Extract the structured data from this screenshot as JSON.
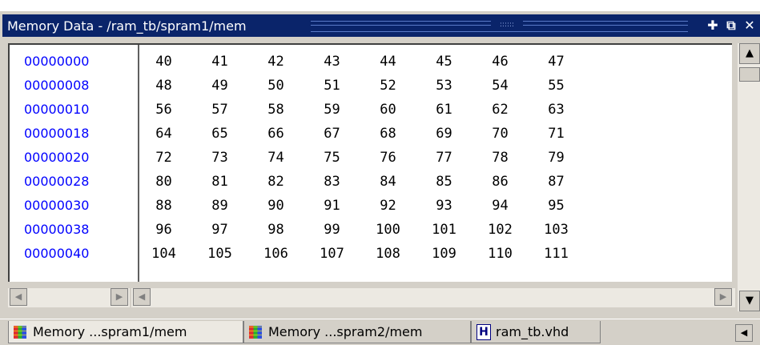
{
  "window": {
    "title": "Memory Data - /ram_tb/spram1/mem"
  },
  "memory": {
    "rows": [
      {
        "address": "00000000",
        "values": [
          "40",
          "41",
          "42",
          "43",
          "44",
          "45",
          "46",
          "47"
        ]
      },
      {
        "address": "00000008",
        "values": [
          "48",
          "49",
          "50",
          "51",
          "52",
          "53",
          "54",
          "55"
        ]
      },
      {
        "address": "00000010",
        "values": [
          "56",
          "57",
          "58",
          "59",
          "60",
          "61",
          "62",
          "63"
        ]
      },
      {
        "address": "00000018",
        "values": [
          "64",
          "65",
          "66",
          "67",
          "68",
          "69",
          "70",
          "71"
        ]
      },
      {
        "address": "00000020",
        "values": [
          "72",
          "73",
          "74",
          "75",
          "76",
          "77",
          "78",
          "79"
        ]
      },
      {
        "address": "00000028",
        "values": [
          "80",
          "81",
          "82",
          "83",
          "84",
          "85",
          "86",
          "87"
        ]
      },
      {
        "address": "00000030",
        "values": [
          "88",
          "89",
          "90",
          "91",
          "92",
          "93",
          "94",
          "95"
        ]
      },
      {
        "address": "00000038",
        "values": [
          "96",
          "97",
          "98",
          "99",
          "100",
          "101",
          "102",
          "103"
        ]
      },
      {
        "address": "00000040",
        "values": [
          "104",
          "105",
          "106",
          "107",
          "108",
          "109",
          "110",
          "111"
        ]
      }
    ]
  },
  "tabs": [
    {
      "label": "Memory ...spram1/mem",
      "icon": "memory-icon",
      "active": true
    },
    {
      "label": "Memory ...spram2/mem",
      "icon": "memory-icon",
      "active": false
    },
    {
      "label": "ram_tb.vhd",
      "icon": "vhdl-file-icon",
      "active": false
    }
  ]
}
